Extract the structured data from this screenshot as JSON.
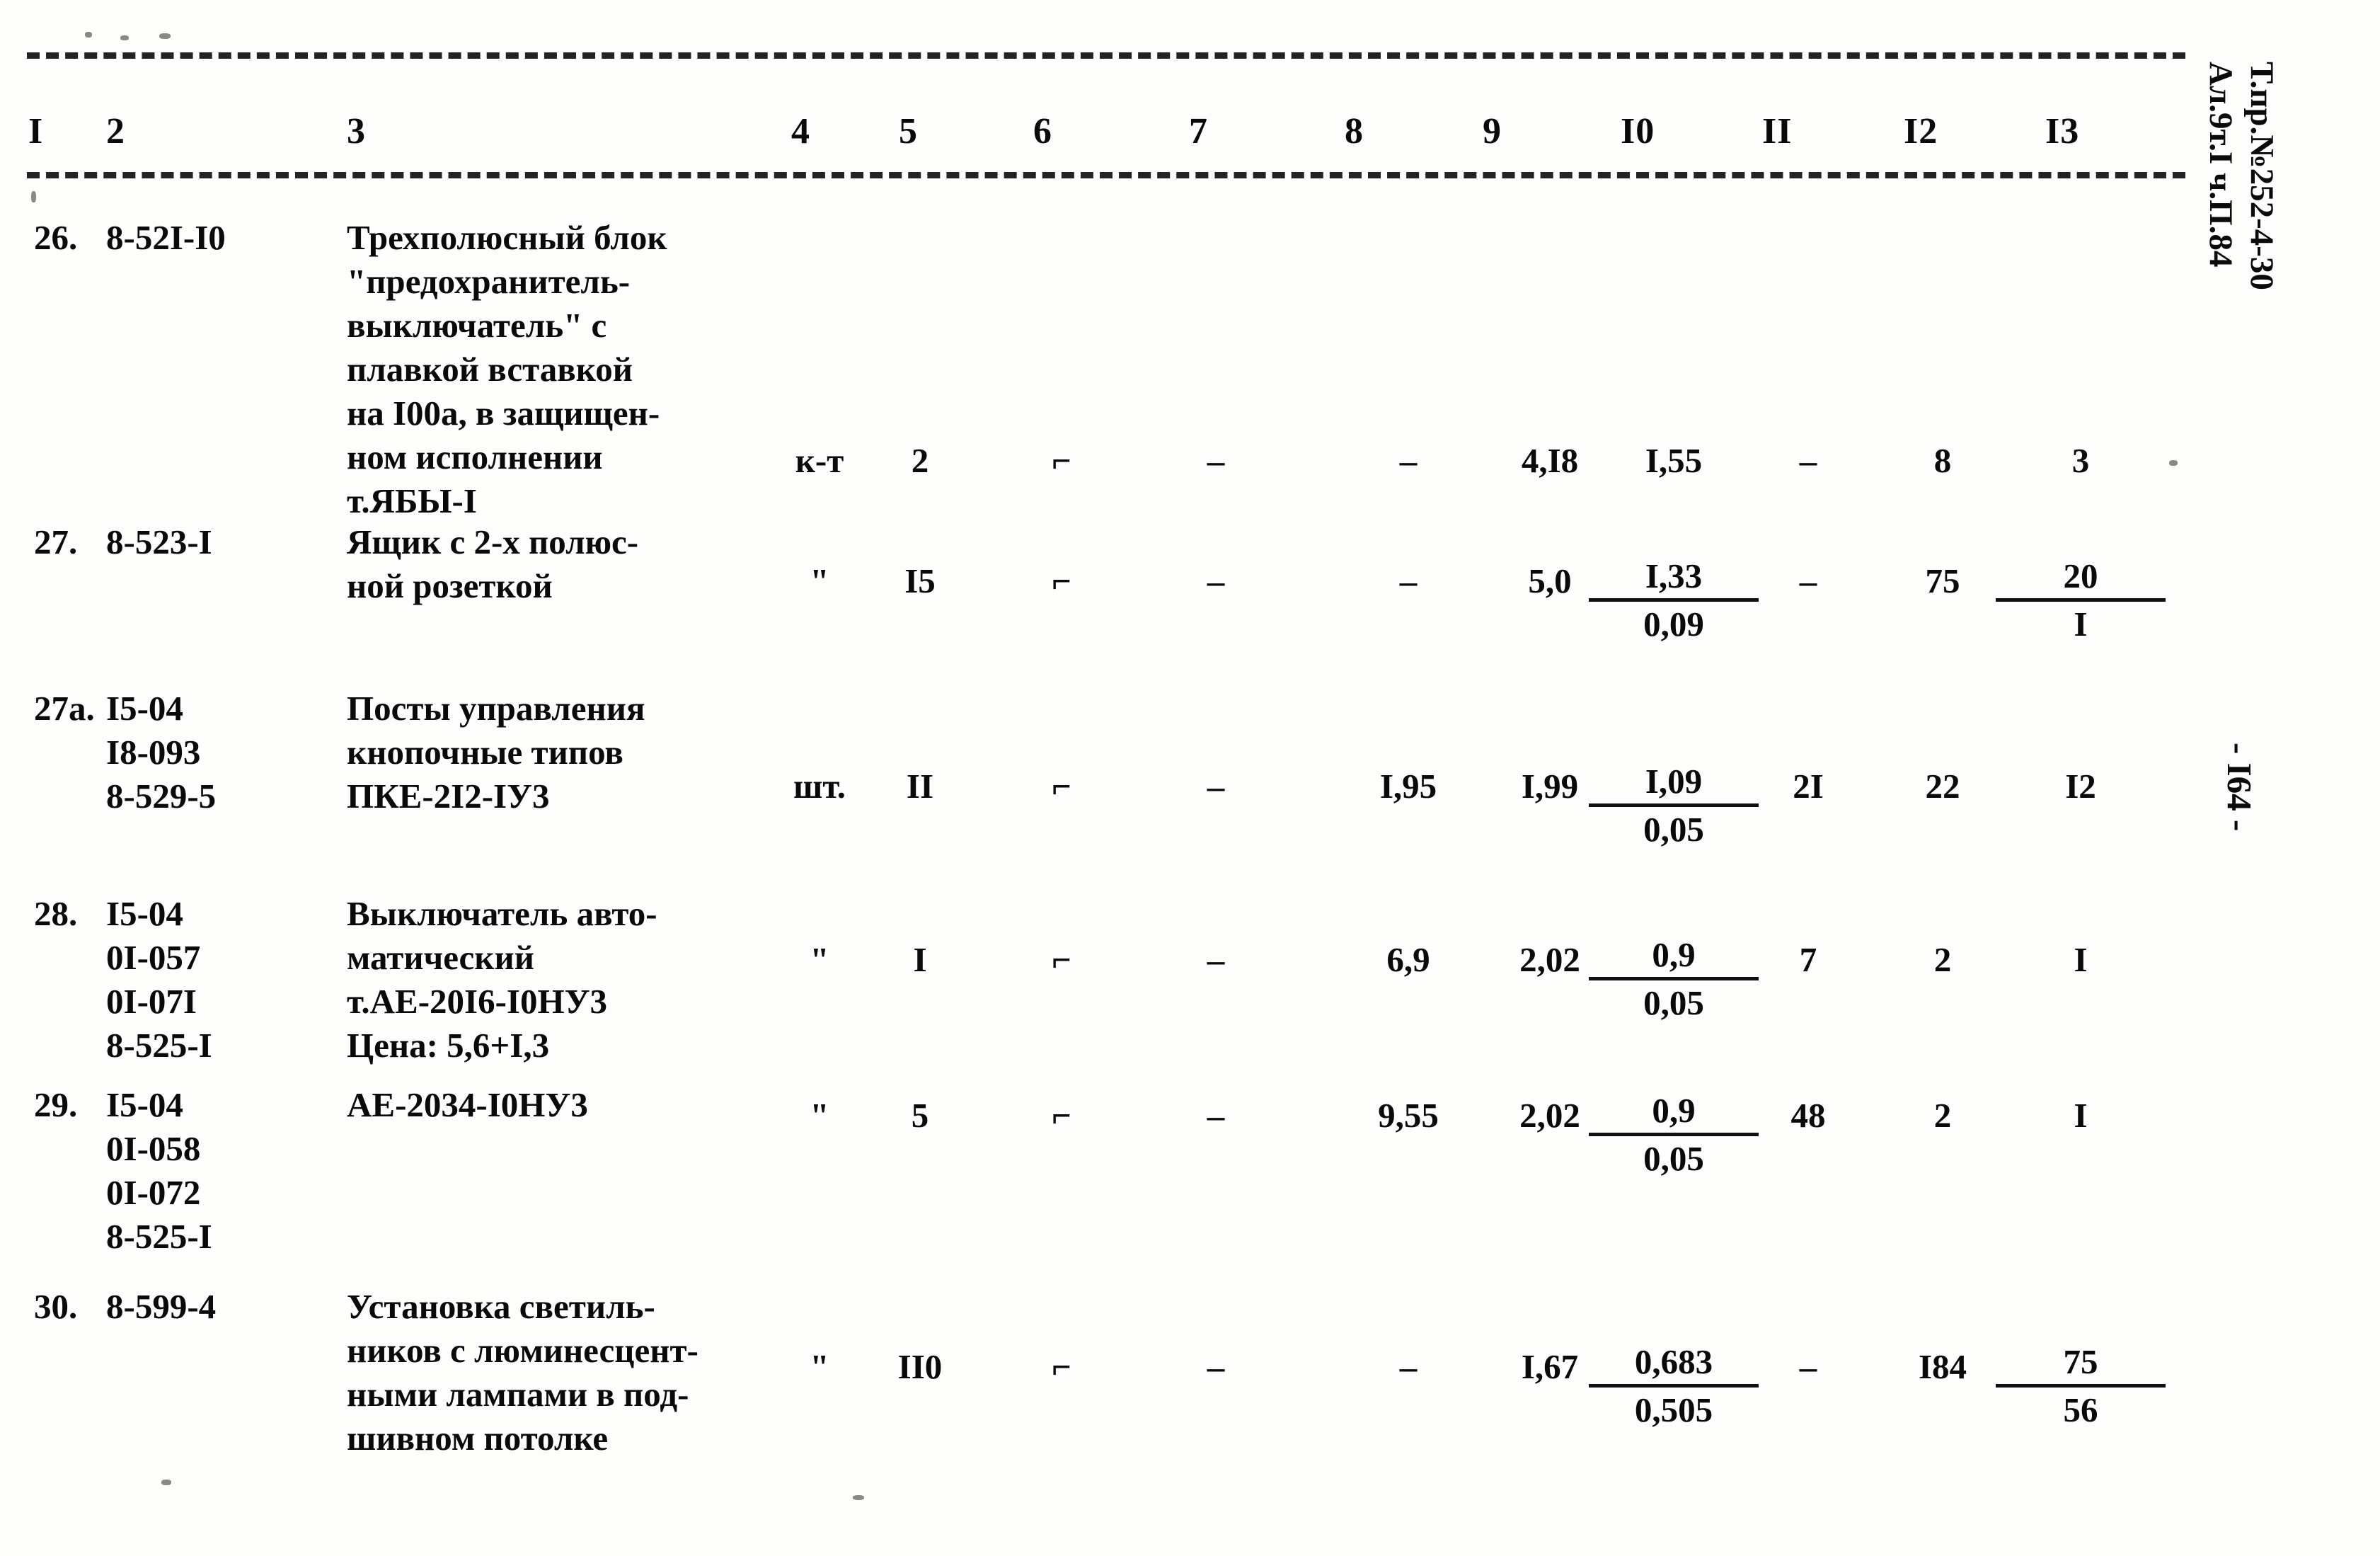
{
  "document": {
    "page_number_label": "- I64 -",
    "margin_note_line1": "Т.пр.№252-4-30",
    "margin_note_line2": "Ал.9т.I ч.П.84"
  },
  "table": {
    "column_headers": [
      "I",
      "2",
      "3",
      "4",
      "5",
      "6",
      "7",
      "8",
      "9",
      "I0",
      "II",
      "I2",
      "I3"
    ],
    "rows": [
      {
        "no": "26.",
        "codes": [
          "8-52I-I0"
        ],
        "description": [
          "Трехполюсный блок",
          "\"предохранитель-",
          "выключатель\" с",
          "плавкой вставкой",
          "на I00а, в защищен-",
          "ном исполнении",
          "т.ЯБЫ-I"
        ],
        "unit": "к-т",
        "qty": "2",
        "c6": "⌐",
        "c7": "–",
        "c8": "–",
        "c9": "4,I8",
        "c10": "I,55",
        "c10_denom": "",
        "c11": "–",
        "c12": "8",
        "c13": "3",
        "c13_denom": ""
      },
      {
        "no": "27.",
        "codes": [
          "8-523-I"
        ],
        "description": [
          "Ящик с 2-х полюс-",
          "ной розеткой"
        ],
        "unit": "\"",
        "qty": "I5",
        "c6": "⌐",
        "c7": "–",
        "c8": "–",
        "c9": "5,0",
        "c10": "I,33",
        "c10_denom": "0,09",
        "c11": "–",
        "c12": "75",
        "c13": "20",
        "c13_denom": "I"
      },
      {
        "no": "27а.",
        "codes": [
          "I5-04",
          "I8-093",
          "8-529-5"
        ],
        "description": [
          "Посты управления",
          "кнопочные типов",
          "ПКЕ-2I2-IУ3"
        ],
        "unit": "шт.",
        "qty": "II",
        "c6": "⌐",
        "c7": "–",
        "c8": "I,95",
        "c9": "I,99",
        "c10": "I,09",
        "c10_denom": "0,05",
        "c11": "2I",
        "c12": "22",
        "c13": "I2",
        "c13_denom": ""
      },
      {
        "no": "28.",
        "codes": [
          "I5-04",
          "0I-057",
          "0I-07I",
          "8-525-I"
        ],
        "description": [
          "Выключатель авто-",
          "матический",
          "т.АЕ-20I6-I0НУ3",
          "Цена: 5,6+I,3"
        ],
        "unit": "\"",
        "qty": "I",
        "c6": "⌐",
        "c7": "–",
        "c8": "6,9",
        "c9": "2,02",
        "c10": "0,9",
        "c10_denom": "0,05",
        "c11": "7",
        "c12": "2",
        "c13": "I",
        "c13_denom": ""
      },
      {
        "no": "29.",
        "codes": [
          "I5-04",
          "0I-058",
          "0I-072",
          "8-525-I"
        ],
        "description": [
          "АЕ-2034-I0НУ3"
        ],
        "unit": "\"",
        "qty": "5",
        "c6": "⌐",
        "c7": "–",
        "c8": "9,55",
        "c9": "2,02",
        "c10": "0,9",
        "c10_denom": "0,05",
        "c11": "48",
        "c12": "2",
        "c13": "I",
        "c13_denom": ""
      },
      {
        "no": "30.",
        "codes": [
          "8-599-4"
        ],
        "description": [
          "Установка светиль-",
          "ников с люминесцент-",
          "ными лампами в под-",
          "шивном потолке"
        ],
        "unit": "\"",
        "qty": "II0",
        "c6": "⌐",
        "c7": "–",
        "c8": "–",
        "c9": "I,67",
        "c10": "0,683",
        "c10_denom": "0,505",
        "c11": "–",
        "c12": "I84",
        "c13": "75",
        "c13_denom": "56"
      }
    ]
  }
}
